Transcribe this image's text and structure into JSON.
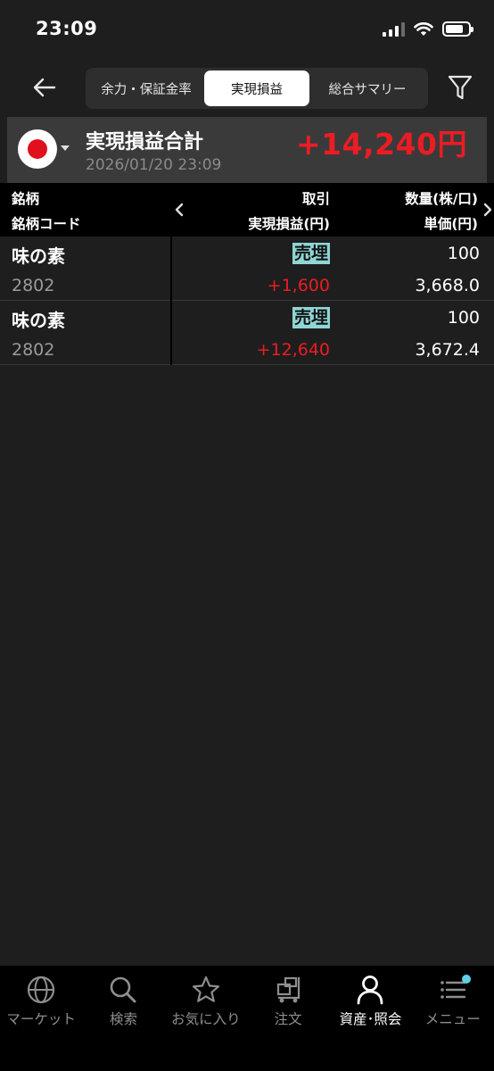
{
  "status_bar": {
    "time": "23:09"
  },
  "header": {
    "tabs": [
      {
        "label": "余力・保証金率",
        "active": false
      },
      {
        "label": "実現損益",
        "active": true
      },
      {
        "label": "総合サマリー",
        "active": false
      }
    ]
  },
  "summary": {
    "title": "実現損益合計",
    "date": "2026/01/20 23:09",
    "total": "+14,240円"
  },
  "table": {
    "headers": {
      "col1_top": "銘柄",
      "col1_bottom": "銘柄コード",
      "col2_top": "取引",
      "col2_bottom": "実現損益(円)",
      "col3_top": "数量(株/口)",
      "col3_bottom": "単価(円)"
    },
    "rows": [
      {
        "name": "味の素",
        "code": "2802",
        "trade": "売埋",
        "pl": "+1,600",
        "qty": "100",
        "price": "3,668.0"
      },
      {
        "name": "味の素",
        "code": "2802",
        "trade": "売埋",
        "pl": "+12,640",
        "qty": "100",
        "price": "3,672.4"
      }
    ]
  },
  "tab_bar": {
    "items": [
      {
        "label": "マーケット",
        "icon": "globe-icon"
      },
      {
        "label": "検索",
        "icon": "search-icon"
      },
      {
        "label": "お気に入り",
        "icon": "star-icon"
      },
      {
        "label": "注文",
        "icon": "cart-icon"
      },
      {
        "label": "資産･照会",
        "icon": "person-icon",
        "active": true
      },
      {
        "label": "メニュー",
        "icon": "menu-icon"
      }
    ]
  },
  "colors": {
    "positive": "#ec1c24",
    "trade_badge": "#8fd6d4",
    "badge_dot": "#5fd0e8"
  }
}
